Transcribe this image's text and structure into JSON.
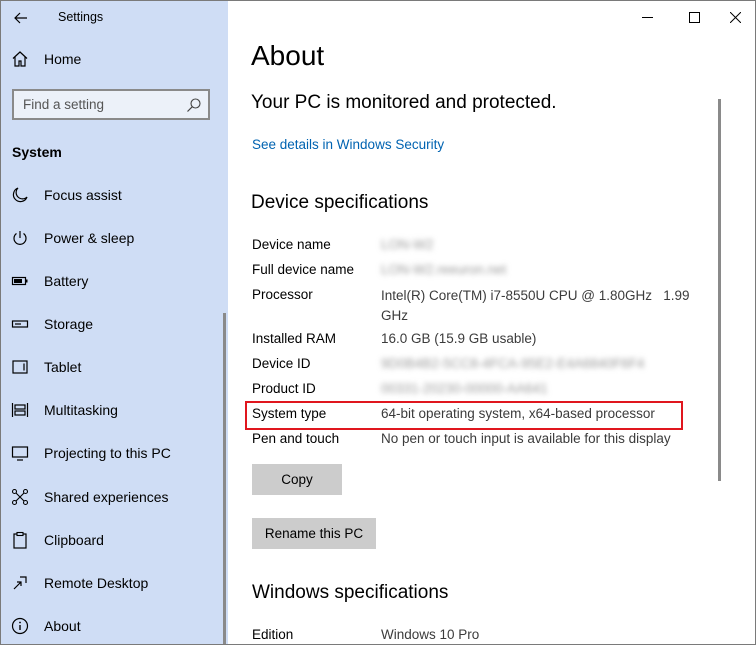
{
  "window": {
    "app_title": "Settings",
    "controls": {
      "minimize": "minimize",
      "maximize": "maximize",
      "close": "close"
    }
  },
  "sidebar": {
    "home_label": "Home",
    "search": {
      "placeholder": "Find a setting"
    },
    "section_heading": "System",
    "items": [
      {
        "label": "Focus assist",
        "icon": "moon-icon"
      },
      {
        "label": "Power & sleep",
        "icon": "power-icon"
      },
      {
        "label": "Battery",
        "icon": "battery-icon"
      },
      {
        "label": "Storage",
        "icon": "storage-icon"
      },
      {
        "label": "Tablet",
        "icon": "tablet-icon"
      },
      {
        "label": "Multitasking",
        "icon": "multitasking-icon"
      },
      {
        "label": "Projecting to this PC",
        "icon": "projecting-icon"
      },
      {
        "label": "Shared experiences",
        "icon": "shared-experiences-icon"
      },
      {
        "label": "Clipboard",
        "icon": "clipboard-icon"
      },
      {
        "label": "Remote Desktop",
        "icon": "remote-desktop-icon"
      },
      {
        "label": "About",
        "icon": "info-icon"
      }
    ]
  },
  "main": {
    "title": "About",
    "protection_heading": "Your PC is monitored and protected.",
    "security_link": "See details in Windows Security",
    "device_specs_heading": "Device specifications",
    "specs": {
      "device_name": {
        "label": "Device name",
        "value": "LON-W2"
      },
      "full_device_name": {
        "label": "Full device name",
        "value": "LON-W2.reeuron.net"
      },
      "processor": {
        "label": "Processor",
        "value": "Intel(R) Core(TM) i7-8550U CPU @ 1.80GHz   1.99 GHz"
      },
      "installed_ram": {
        "label": "Installed RAM",
        "value": "16.0 GB (15.9 GB usable)"
      },
      "device_id": {
        "label": "Device ID",
        "value": "9D0B4B2-5CC8-4FCA-95E2-E4A6840F6F4"
      },
      "product_id": {
        "label": "Product ID",
        "value": "00331-20230-00000-AA641"
      },
      "system_type": {
        "label": "System type",
        "value": "64-bit operating system, x64-based processor"
      },
      "pen_touch": {
        "label": "Pen and touch",
        "value": "No pen or touch input is available for this display"
      }
    },
    "copy_button": "Copy",
    "rename_button": "Rename this PC",
    "windows_specs_heading": "Windows specifications",
    "edition": {
      "label": "Edition",
      "value": "Windows 10 Pro"
    }
  },
  "colors": {
    "sidebar_bg": "#cfddf5",
    "link": "#0063b1",
    "highlight": "#e0161e",
    "button_bg": "#cccccc"
  }
}
